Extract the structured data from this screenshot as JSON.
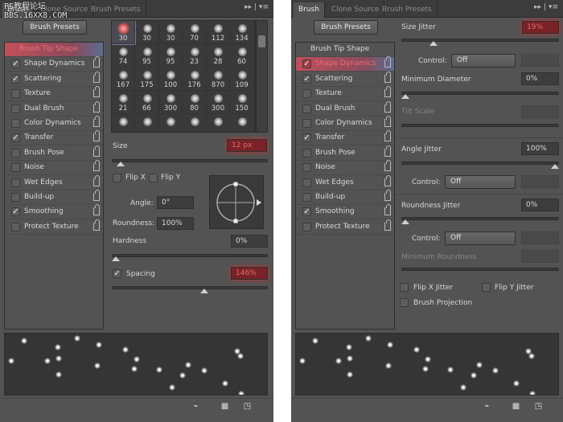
{
  "tabs": [
    "Brush",
    "Clone Source",
    "Brush Presets"
  ],
  "brush_presets_button": "Brush Presets",
  "list_items": [
    {
      "label": "Brush Tip Shape",
      "checked": null
    },
    {
      "label": "Shape Dynamics",
      "checked": true
    },
    {
      "label": "Scattering",
      "checked": true
    },
    {
      "label": "Texture",
      "checked": false
    },
    {
      "label": "Dual Brush",
      "checked": false
    },
    {
      "label": "Color Dynamics",
      "checked": false
    },
    {
      "label": "Transfer",
      "checked": true
    },
    {
      "label": "Brush Pose",
      "checked": false
    },
    {
      "label": "Noise",
      "checked": false
    },
    {
      "label": "Wet Edges",
      "checked": false
    },
    {
      "label": "Build-up",
      "checked": false
    },
    {
      "label": "Smoothing",
      "checked": true
    },
    {
      "label": "Protect Texture",
      "checked": false
    }
  ],
  "watermark": {
    "line1": "PS教程论坛",
    "line2": "BBS.16XX8.COM"
  },
  "left": {
    "highlighted": "Brush Tip Shape",
    "brush_sizes": [
      30,
      30,
      30,
      70,
      112,
      134,
      74,
      95,
      95,
      23,
      28,
      60,
      167,
      175,
      100,
      176,
      870,
      109,
      21,
      66,
      300,
      80,
      300,
      150
    ],
    "size_label": "Size",
    "size_value": "12 px",
    "size_slider": 0.03,
    "flip_x": "Flip X",
    "flip_y": "Flip Y",
    "angle_label": "Angle:",
    "angle_value": "0°",
    "roundness_label": "Roundness:",
    "roundness_value": "100%",
    "hardness_label": "Hardness",
    "hardness_value": "0%",
    "hardness_slider": 0,
    "spacing_label": "Spacing",
    "spacing_checked": true,
    "spacing_value": "146%",
    "spacing_slider": 0.6
  },
  "right": {
    "highlighted": "Shape Dynamics",
    "size_jitter_label": "Size Jitter",
    "size_jitter_value": "19%",
    "size_jitter_slider": 0.19,
    "control_label": "Control:",
    "control_value": "Off",
    "min_diameter_label": "Minimum Diameter",
    "min_diameter_value": "0%",
    "min_diameter_slider": 0,
    "tilt_scale_label": "Tilt Scale",
    "angle_jitter_label": "Angle Jitter",
    "angle_jitter_value": "100%",
    "angle_jitter_slider": 1,
    "roundness_jitter_label": "Roundness Jitter",
    "roundness_jitter_value": "0%",
    "roundness_jitter_slider": 0,
    "min_roundness_label": "Minimum Roundness",
    "flip_x_jitter": "Flip X Jitter",
    "flip_y_jitter": "Flip Y Jitter",
    "brush_projection": "Brush Projection"
  },
  "colors": {
    "panel": "#535353",
    "highlight": "#c0505a",
    "field_highlight": "#7a2228"
  }
}
